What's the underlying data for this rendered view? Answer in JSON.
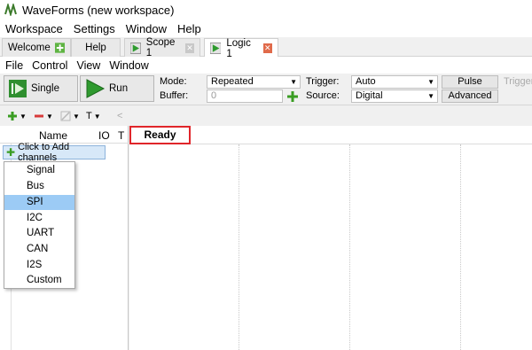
{
  "window": {
    "title": "WaveForms  (new workspace)"
  },
  "main_menu": [
    "Workspace",
    "Settings",
    "Window",
    "Help"
  ],
  "tabs": [
    {
      "label": "Welcome",
      "state": "inactive"
    },
    {
      "label": "Help",
      "state": "inactive"
    },
    {
      "label": "Scope 1",
      "state": "inactive"
    },
    {
      "label": "Logic 1",
      "state": "active"
    }
  ],
  "instrument_menu": [
    "File",
    "Control",
    "View",
    "Window"
  ],
  "toolbar": {
    "single_label": "Single",
    "run_label": "Run",
    "mode_label": "Mode:",
    "mode_value": "Repeated",
    "buffer_label": "Buffer:",
    "buffer_value": "0",
    "trigger_label": "Trigger:",
    "trigger_value": "Auto",
    "source_label": "Source:",
    "source_value": "Digital",
    "pulse_label": "Pulse",
    "advanced_label": "Advanced",
    "trigger_cut_label": "Trigger"
  },
  "iconbar": {
    "text_tool": "T",
    "back": "<"
  },
  "channel_panel": {
    "col_name": "Name",
    "col_io": "IO",
    "col_t": "T",
    "add_channels_label": "Click to Add channels"
  },
  "add_menu": {
    "items": [
      "Signal",
      "Bus",
      "SPI",
      "I2C",
      "UART",
      "CAN",
      "I2S",
      "Custom"
    ],
    "selected": "SPI"
  },
  "status": {
    "ready_label": "Ready"
  },
  "colors": {
    "accent_green": "#3a9d23",
    "ready_border": "#e0252a",
    "selection": "#9ccbf5"
  }
}
